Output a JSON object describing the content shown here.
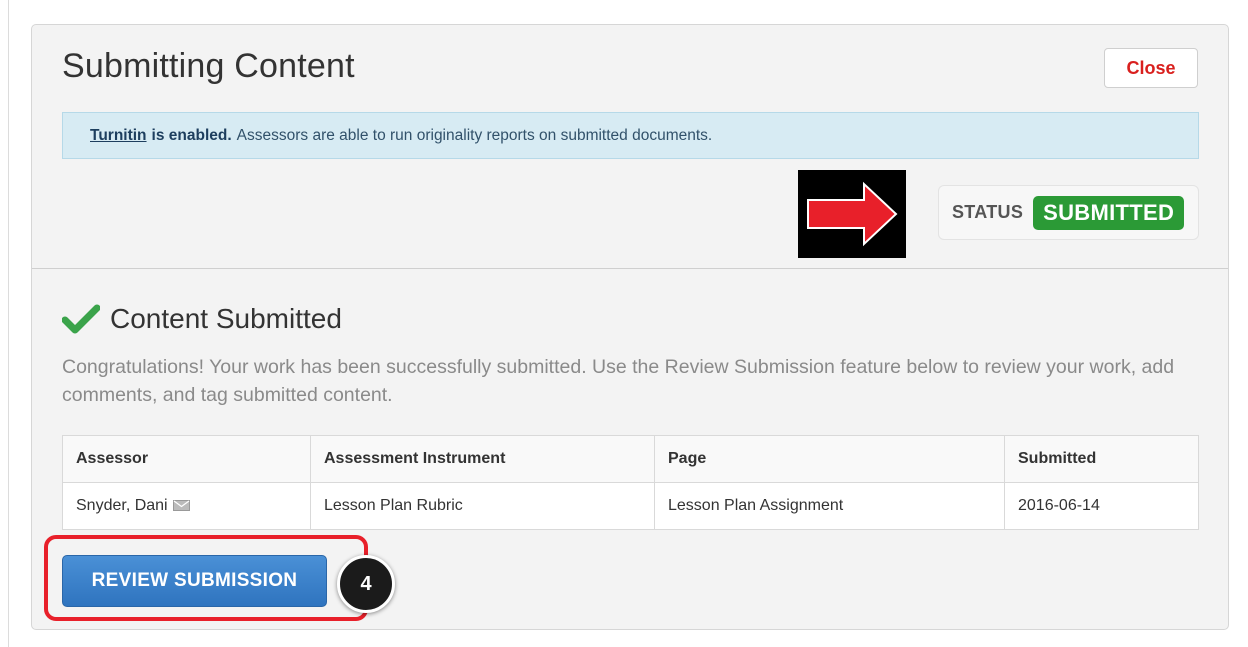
{
  "modal": {
    "title": "Submitting Content",
    "close_label": "Close"
  },
  "banner": {
    "link_text": "Turnitin",
    "strong_text": "is enabled.",
    "text": "Assessors are able to run originality reports on submitted documents."
  },
  "status": {
    "label": "STATUS",
    "value": "SUBMITTED",
    "value_color": "#2b9a36"
  },
  "annotation": {
    "arrow_color": "#e8202a",
    "step_number": "4"
  },
  "content": {
    "icon": "checkmark-icon",
    "title": "Content Submitted",
    "message": "Congratulations! Your work has been successfully submitted. Use the Review Submission feature below to review your work, add comments, and tag submitted content."
  },
  "table": {
    "headers": [
      "Assessor",
      "Assessment Instrument",
      "Page",
      "Submitted"
    ],
    "rows": [
      {
        "assessor": "Snyder, Dani",
        "assessor_icon": "envelope-icon",
        "instrument": "Lesson Plan Rubric",
        "page": "Lesson Plan Assignment",
        "submitted": "2016-06-14"
      }
    ]
  },
  "actions": {
    "review_label": "REVIEW SUBMISSION"
  }
}
